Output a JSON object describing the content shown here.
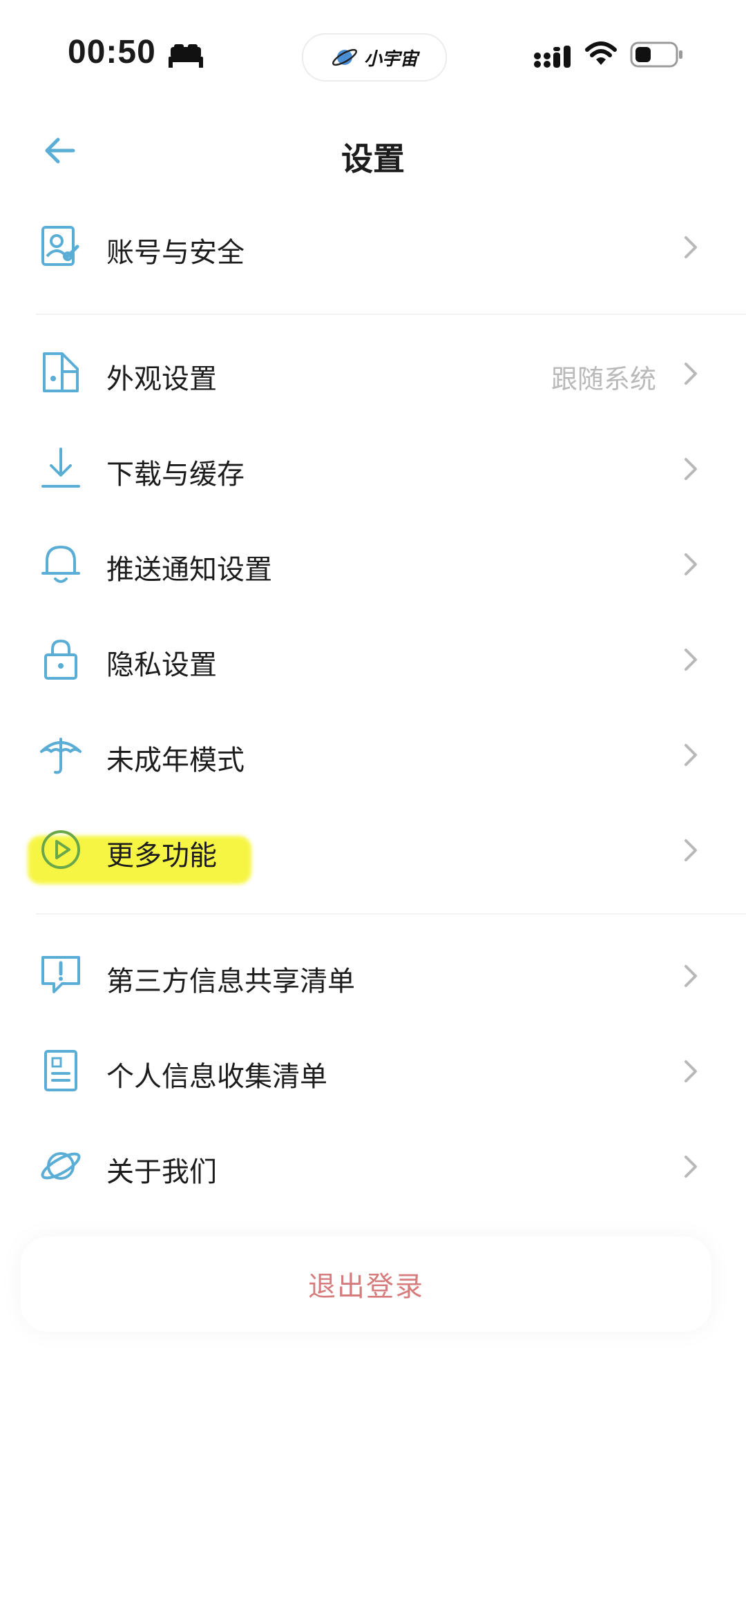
{
  "status_bar": {
    "time": "00:50",
    "app_pill_label": "小宇宙",
    "battery_level": 0.4
  },
  "header": {
    "title": "设置"
  },
  "settings": [
    {
      "label": "账号与安全",
      "value": "",
      "icon": "account-security-icon"
    },
    {
      "label": "外观设置",
      "value": "跟随系统",
      "icon": "appearance-icon"
    },
    {
      "label": "下载与缓存",
      "value": "",
      "icon": "download-icon"
    },
    {
      "label": "推送通知设置",
      "value": "",
      "icon": "bell-icon"
    },
    {
      "label": "隐私设置",
      "value": "",
      "icon": "lock-icon"
    },
    {
      "label": "未成年模式",
      "value": "",
      "icon": "umbrella-icon"
    },
    {
      "label": "更多功能",
      "value": "",
      "icon": "play-circle-icon",
      "highlighted": true
    },
    {
      "label": "第三方信息共享清单",
      "value": "",
      "icon": "chat-alert-icon"
    },
    {
      "label": "个人信息收集清单",
      "value": "",
      "icon": "document-list-icon"
    },
    {
      "label": "关于我们",
      "value": "",
      "icon": "planet-icon"
    }
  ],
  "logout": {
    "label": "退出登录"
  },
  "colors": {
    "icon_blue": "#5aaed6",
    "logout_red": "#d67c7c",
    "value_gray": "#b9b9b9",
    "highlight_yellow": "#f6f53a",
    "play_icon_green": "#6aa64a"
  }
}
